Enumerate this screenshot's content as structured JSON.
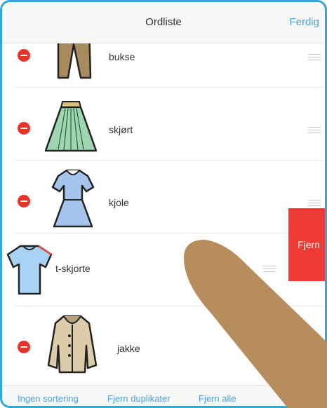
{
  "navbar": {
    "title": "Ordliste",
    "done_label": "Ferdig"
  },
  "list": {
    "items": [
      {
        "label": "bukse",
        "icon": "trousers-icon"
      },
      {
        "label": "skjørt",
        "icon": "skirt-icon"
      },
      {
        "label": "kjole",
        "icon": "dress-icon"
      },
      {
        "label": "t-skjorte",
        "icon": "t-shirt-icon"
      },
      {
        "label": "jakke",
        "icon": "jacket-icon"
      }
    ],
    "swiped_row_action": "Fjern"
  },
  "toolbar": {
    "no_sorting": "Ingen sortering",
    "remove_duplicates": "Fjern duplikater",
    "remove_all": "Fjern alle"
  },
  "colors": {
    "frame": "#2fa6dc",
    "accent": "#49a2d9",
    "delete": "#e6332a",
    "swipe_action": "#ef3a35",
    "finger": "#b88d5e"
  }
}
